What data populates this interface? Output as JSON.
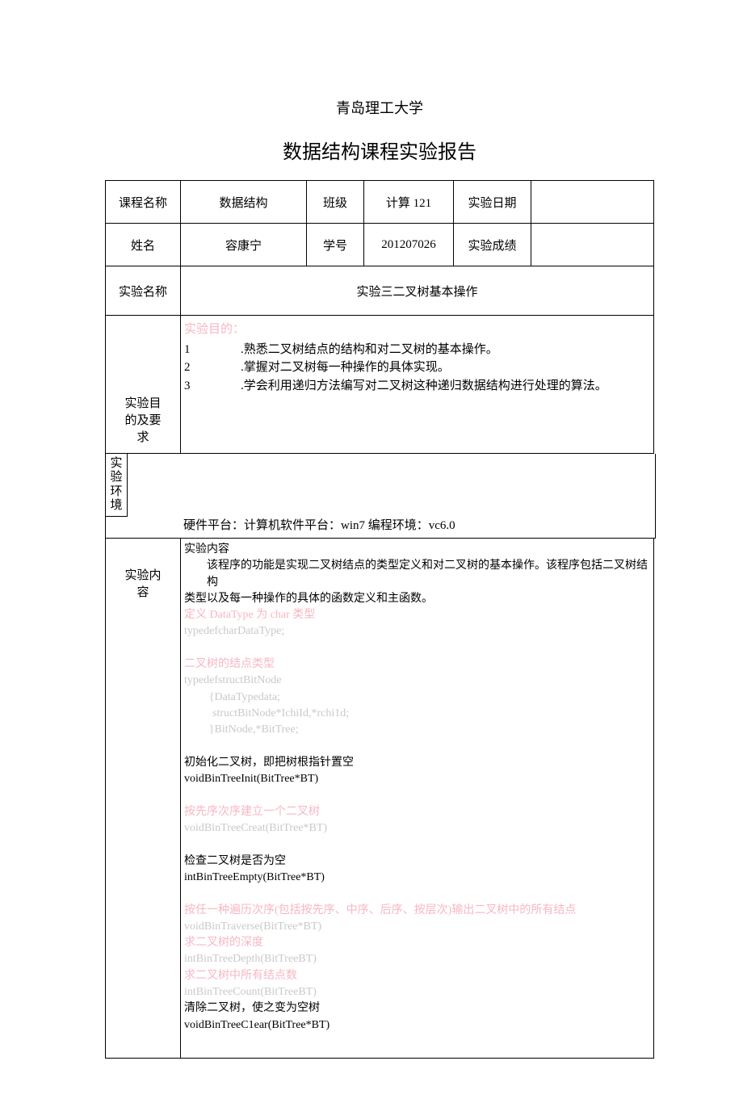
{
  "heading": {
    "university": "青岛理工大学",
    "report_title": "数据结构课程实验报告"
  },
  "info_grid": {
    "course_label": "课程名称",
    "course_value": "数据结构",
    "class_label": "班级",
    "class_value": "计算 121",
    "date_label": "实验日期",
    "date_value": "",
    "name_label": "姓名",
    "name_value": "容康宁",
    "id_label": "学号",
    "id_value": "201207026",
    "score_label": "实验成绩",
    "score_value": ""
  },
  "exp_name": {
    "label": "实验名称",
    "value": "实验三二叉树基本操作"
  },
  "purpose": {
    "side_label_l1": "实验目",
    "side_label_l2": "的及要",
    "side_label_l3": "求",
    "heading": "实验目的：",
    "items": [
      {
        "n": "1",
        "t": ".熟悉二叉树结点的结构和对二叉树的基本操作。"
      },
      {
        "n": "2",
        "t": ".掌握对二叉树每一种操作的具体实现。"
      },
      {
        "n": "3",
        "t": ".学会利用递归方法编写对二叉树这种递归数据结构进行处理的算法。"
      }
    ]
  },
  "environment": {
    "side_label": "实验环境",
    "text": "硬件平台：计算机软件平台：win7 编程环境：vc6.0"
  },
  "content": {
    "side_label_l1": "实验内",
    "side_label_l2": "容",
    "h1": "实验内容",
    "p1": "该程序的功能是实现二叉树结点的类型定义和对二叉树的基本操作。该程序包括二叉树结构",
    "p1b": "类型以及每一种操作的具体的函数定义和主函数。",
    "c1": "定义 DataType 为 char 类型",
    "c2": "typedefcharDataType;",
    "c3": "二叉树的结点类型",
    "c4": "typedefstructBitNode",
    "c5": "{DataTypedata;",
    "c6": "structBitNode*IchiId,*rchi1d;",
    "c7": "}BitNode,*BitTree;",
    "s1": "初始化二叉树，即把树根指针置空",
    "s2": "voidBinTreeInit(BitTree*BT)",
    "s3": "按先序次序建立一个二叉树",
    "s4": "voidBinTreeCreat(BitTree*BT)",
    "s5": "检查二叉树是否为空",
    "s6": "intBinTreeEmpty(BitTree*BT)",
    "s7": "按任一种遍历次序(包括按先序、中序、后序、按层次)输出二叉树中的所有结点",
    "s8": "voidBinTraverse(BitTree*BT)",
    "s9": "求二叉树的深度",
    "s10": "intBinTreeDepth(BitTreeBT)",
    "s11": "求二叉树中所有结点数",
    "s12": "intBinTreeCount(BitTreeBT)",
    "s13": "清除二叉树，使之变为空树",
    "s14": "voidBinTreeC1ear(BitTree*BT)"
  }
}
